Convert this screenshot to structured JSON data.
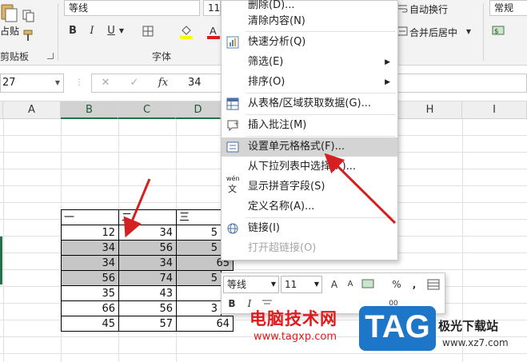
{
  "ribbon": {
    "paste_label": "占贴",
    "clipboard_label": "剪贴板",
    "font_group_label": "字体",
    "font_name": "等线",
    "font_size": "11",
    "bold": "B",
    "italic": "I",
    "underline": "U",
    "wrap_text": "自动换行",
    "merge_center": "合并后居中",
    "number_format": "常规"
  },
  "formula_bar": {
    "name_box": "27",
    "fx_label": "fx",
    "cancel": "✕",
    "confirm": "✓",
    "value": "34"
  },
  "columns": [
    "A",
    "B",
    "C",
    "D",
    "H",
    "I"
  ],
  "table": {
    "headers": [
      "一",
      "二",
      "三"
    ],
    "rows": [
      [
        "12",
        "34",
        "5"
      ],
      [
        "34",
        "56",
        "5"
      ],
      [
        "34",
        "34",
        "65"
      ],
      [
        "56",
        "74",
        "5"
      ],
      [
        "35",
        "43",
        ""
      ],
      [
        "66",
        "56",
        "3"
      ],
      [
        "45",
        "57",
        "64"
      ]
    ]
  },
  "context_menu": {
    "items": [
      {
        "label": "删除(D)...",
        "icon": ""
      },
      {
        "label": "清除内容(N)",
        "icon": ""
      },
      {
        "label": "快速分析(Q)",
        "icon": "quick-analysis-icon"
      },
      {
        "label": "筛选(E)",
        "icon": "",
        "submenu": true
      },
      {
        "label": "排序(O)",
        "icon": "",
        "submenu": true
      },
      {
        "label": "从表格/区域获取数据(G)...",
        "icon": "table-icon"
      },
      {
        "label": "插入批注(M)",
        "icon": "comment-icon"
      },
      {
        "label": "设置单元格格式(F)...",
        "icon": "format-cells-icon"
      },
      {
        "label": "从下拉列表中选择(K)...",
        "icon": ""
      },
      {
        "label": "显示拼音字段(S)",
        "icon": "phonetic-icon"
      },
      {
        "label": "定义名称(A)...",
        "icon": ""
      },
      {
        "label": "链接(I)",
        "icon": "link-icon"
      },
      {
        "label": "打开超链接(O)",
        "icon": ""
      }
    ],
    "phonetic_glyph": "wén",
    "phonetic_char": "文"
  },
  "mini_toolbar": {
    "font_name": "等线",
    "font_size": "11",
    "grow": "A",
    "shrink": "A",
    "percent": "%",
    "comma": ",",
    "bold": "B",
    "italic": "I",
    "decimals": "00"
  },
  "watermark": {
    "cn": "电脑技术网",
    "url": "www.tagxp.com",
    "tag": "TAG",
    "site": "极光下载站",
    "site_url": "www.xz7.com"
  },
  "colors": {
    "excel_green": "#217346",
    "selection_gray": "#c6c6c6",
    "arrow_red": "#d42020",
    "tag_blue": "#1d76c8",
    "watermark_red": "#e01a1a"
  }
}
